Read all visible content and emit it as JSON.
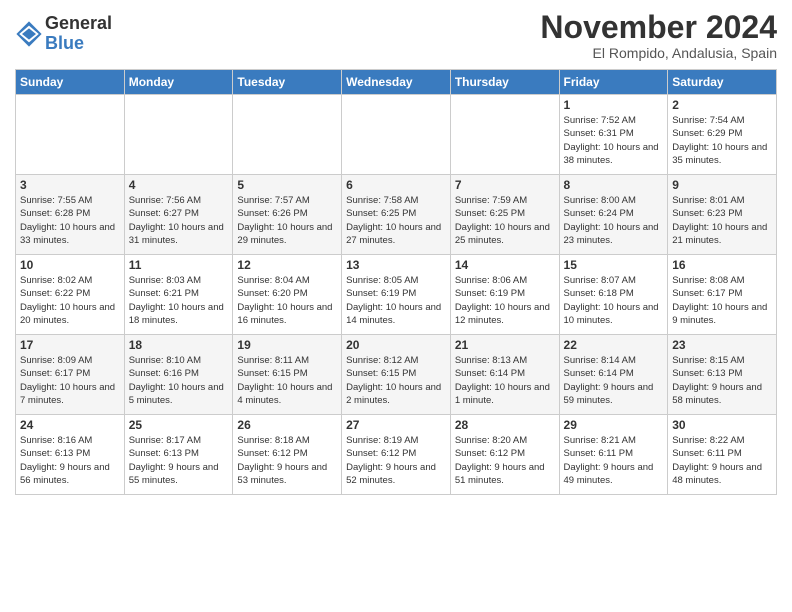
{
  "logo": {
    "general": "General",
    "blue": "Blue"
  },
  "title": "November 2024",
  "location": "El Rompido, Andalusia, Spain",
  "days_of_week": [
    "Sunday",
    "Monday",
    "Tuesday",
    "Wednesday",
    "Thursday",
    "Friday",
    "Saturday"
  ],
  "weeks": [
    [
      {
        "day": "",
        "info": ""
      },
      {
        "day": "",
        "info": ""
      },
      {
        "day": "",
        "info": ""
      },
      {
        "day": "",
        "info": ""
      },
      {
        "day": "",
        "info": ""
      },
      {
        "day": "1",
        "info": "Sunrise: 7:52 AM\nSunset: 6:31 PM\nDaylight: 10 hours and 38 minutes."
      },
      {
        "day": "2",
        "info": "Sunrise: 7:54 AM\nSunset: 6:29 PM\nDaylight: 10 hours and 35 minutes."
      }
    ],
    [
      {
        "day": "3",
        "info": "Sunrise: 7:55 AM\nSunset: 6:28 PM\nDaylight: 10 hours and 33 minutes."
      },
      {
        "day": "4",
        "info": "Sunrise: 7:56 AM\nSunset: 6:27 PM\nDaylight: 10 hours and 31 minutes."
      },
      {
        "day": "5",
        "info": "Sunrise: 7:57 AM\nSunset: 6:26 PM\nDaylight: 10 hours and 29 minutes."
      },
      {
        "day": "6",
        "info": "Sunrise: 7:58 AM\nSunset: 6:25 PM\nDaylight: 10 hours and 27 minutes."
      },
      {
        "day": "7",
        "info": "Sunrise: 7:59 AM\nSunset: 6:25 PM\nDaylight: 10 hours and 25 minutes."
      },
      {
        "day": "8",
        "info": "Sunrise: 8:00 AM\nSunset: 6:24 PM\nDaylight: 10 hours and 23 minutes."
      },
      {
        "day": "9",
        "info": "Sunrise: 8:01 AM\nSunset: 6:23 PM\nDaylight: 10 hours and 21 minutes."
      }
    ],
    [
      {
        "day": "10",
        "info": "Sunrise: 8:02 AM\nSunset: 6:22 PM\nDaylight: 10 hours and 20 minutes."
      },
      {
        "day": "11",
        "info": "Sunrise: 8:03 AM\nSunset: 6:21 PM\nDaylight: 10 hours and 18 minutes."
      },
      {
        "day": "12",
        "info": "Sunrise: 8:04 AM\nSunset: 6:20 PM\nDaylight: 10 hours and 16 minutes."
      },
      {
        "day": "13",
        "info": "Sunrise: 8:05 AM\nSunset: 6:19 PM\nDaylight: 10 hours and 14 minutes."
      },
      {
        "day": "14",
        "info": "Sunrise: 8:06 AM\nSunset: 6:19 PM\nDaylight: 10 hours and 12 minutes."
      },
      {
        "day": "15",
        "info": "Sunrise: 8:07 AM\nSunset: 6:18 PM\nDaylight: 10 hours and 10 minutes."
      },
      {
        "day": "16",
        "info": "Sunrise: 8:08 AM\nSunset: 6:17 PM\nDaylight: 10 hours and 9 minutes."
      }
    ],
    [
      {
        "day": "17",
        "info": "Sunrise: 8:09 AM\nSunset: 6:17 PM\nDaylight: 10 hours and 7 minutes."
      },
      {
        "day": "18",
        "info": "Sunrise: 8:10 AM\nSunset: 6:16 PM\nDaylight: 10 hours and 5 minutes."
      },
      {
        "day": "19",
        "info": "Sunrise: 8:11 AM\nSunset: 6:15 PM\nDaylight: 10 hours and 4 minutes."
      },
      {
        "day": "20",
        "info": "Sunrise: 8:12 AM\nSunset: 6:15 PM\nDaylight: 10 hours and 2 minutes."
      },
      {
        "day": "21",
        "info": "Sunrise: 8:13 AM\nSunset: 6:14 PM\nDaylight: 10 hours and 1 minute."
      },
      {
        "day": "22",
        "info": "Sunrise: 8:14 AM\nSunset: 6:14 PM\nDaylight: 9 hours and 59 minutes."
      },
      {
        "day": "23",
        "info": "Sunrise: 8:15 AM\nSunset: 6:13 PM\nDaylight: 9 hours and 58 minutes."
      }
    ],
    [
      {
        "day": "24",
        "info": "Sunrise: 8:16 AM\nSunset: 6:13 PM\nDaylight: 9 hours and 56 minutes."
      },
      {
        "day": "25",
        "info": "Sunrise: 8:17 AM\nSunset: 6:13 PM\nDaylight: 9 hours and 55 minutes."
      },
      {
        "day": "26",
        "info": "Sunrise: 8:18 AM\nSunset: 6:12 PM\nDaylight: 9 hours and 53 minutes."
      },
      {
        "day": "27",
        "info": "Sunrise: 8:19 AM\nSunset: 6:12 PM\nDaylight: 9 hours and 52 minutes."
      },
      {
        "day": "28",
        "info": "Sunrise: 8:20 AM\nSunset: 6:12 PM\nDaylight: 9 hours and 51 minutes."
      },
      {
        "day": "29",
        "info": "Sunrise: 8:21 AM\nSunset: 6:11 PM\nDaylight: 9 hours and 49 minutes."
      },
      {
        "day": "30",
        "info": "Sunrise: 8:22 AM\nSunset: 6:11 PM\nDaylight: 9 hours and 48 minutes."
      }
    ]
  ]
}
